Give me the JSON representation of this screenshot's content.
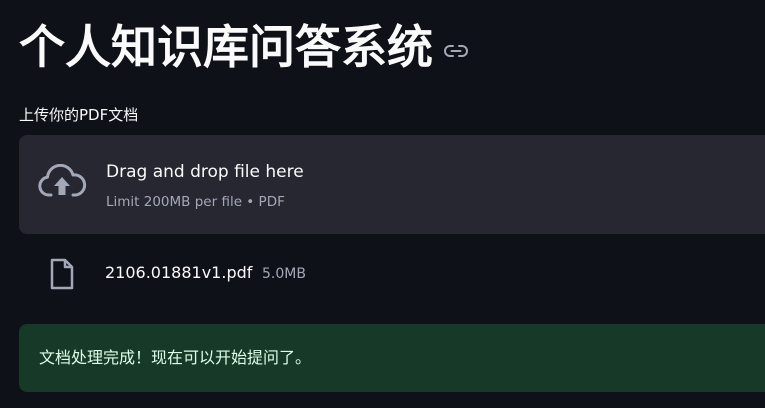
{
  "header": {
    "title": "个人知识库问答系统",
    "link_icon": "link-icon"
  },
  "uploader": {
    "label": "上传你的PDF文档",
    "dropzone_text": "Drag and drop file here",
    "limit_text": "Limit 200MB per file • PDF",
    "icon": "cloud-upload-icon"
  },
  "uploaded_file": {
    "name": "2106.01881v1.pdf",
    "size": "5.0MB",
    "icon": "file-icon"
  },
  "alert": {
    "message": "文档处理完成！现在可以开始提问了。",
    "background": "#173928",
    "text_color": "#dffde9"
  },
  "theme": {
    "background": "#0e1117",
    "surface": "#262730",
    "muted_text": "#a3a8b8"
  }
}
